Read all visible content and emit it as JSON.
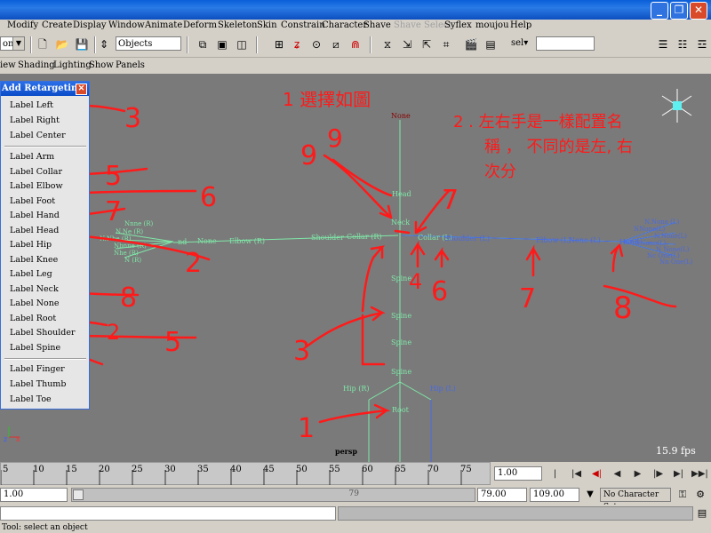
{
  "menubar": [
    "Modify",
    "Create",
    "Display",
    "Window",
    "Animate",
    "Deform",
    "Skeleton",
    "Skin",
    "Constrain",
    "Character",
    "Shave",
    "Shave Select",
    "Syflex",
    "moujou",
    "Help"
  ],
  "toolbar": {
    "mode_value": "on",
    "selection_value": "Objects",
    "sel_value": "sel▾"
  },
  "panel_menu": [
    "iew",
    "Shading",
    "Lighting",
    "Show",
    "Panels"
  ],
  "retarget": {
    "title": "Add Retargeting",
    "items": [
      "Label Left",
      "Label Right",
      "Label Center",
      "Label Arm",
      "Label Collar",
      "Label Elbow",
      "Label Foot",
      "Label Hand",
      "Label Head",
      "Label Hip",
      "Label Knee",
      "Label Leg",
      "Label Neck",
      "Label None",
      "Label Root",
      "Label Shoulder",
      "Label Spine",
      "Label Finger",
      "Label Thumb",
      "Label Toe"
    ]
  },
  "viewport": {
    "camera": "persp",
    "fps": "15.9 fps",
    "joint_labels": {
      "none_top": "None",
      "head": "Head",
      "neck": "Neck",
      "spine": "Spine",
      "root": "Root",
      "hip_r": "Hip (R)",
      "hip_l": "Hip (L)",
      "shoulder_r": "Shoulder",
      "collar_r": "Collar (R)",
      "collar_l": "Collar (L)",
      "shoulder_l": "Shoulder (L)",
      "elbow_r": "Elbow (R)",
      "none_r": "None",
      "hand_r": "nd",
      "elbow_l": "Elbow (L)",
      "none_l": "None (L)",
      "hand_l": "Hand"
    },
    "finger_labels": [
      "Nnne (R)",
      "N.Ne (R)",
      "N.Nhe (R)",
      "Nbnne (R)",
      "Nhe (R)",
      "N (R)"
    ],
    "finger_labels_left": [
      "N.Nona (L)",
      "NNone(L)",
      "N.None(L)",
      "NNone(L)",
      "N None(L)",
      "Nc One(L)",
      "Nn One(L)"
    ],
    "annotations": {
      "a1": "1  選擇如圖",
      "a2_line1": "2 . 左右手是一樣配置名",
      "a2_line2": "稱 ， 不同的是左, 右",
      "a2_line3": "次分",
      "nums": [
        "1",
        "2",
        "3",
        "3",
        "4",
        "5",
        "5",
        "6",
        "6",
        "7",
        "7",
        "7",
        "8",
        "8",
        "9",
        "9",
        "2"
      ]
    },
    "axis": {
      "x": "x",
      "z": "z"
    },
    "colors": {
      "bone": "#7fe8a8",
      "left_side": "#4a6ae0",
      "annotation": "#ff1a1a"
    }
  },
  "timeline": {
    "ticks": [
      "5",
      "10",
      "15",
      "20",
      "25",
      "30",
      "35",
      "40",
      "45",
      "50",
      "55",
      "60",
      "65",
      "70",
      "75"
    ],
    "current": "1.00",
    "start": "1.00",
    "range_end_label": "79",
    "end": "79.00",
    "max": "109.00",
    "character_set": "No Character Set"
  },
  "help_line": "Tool: select an object"
}
